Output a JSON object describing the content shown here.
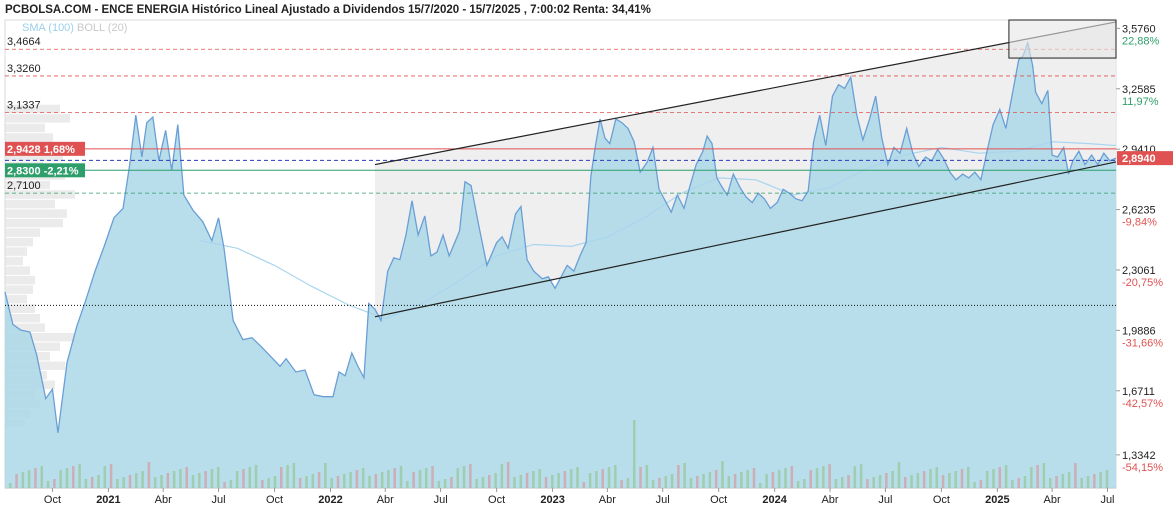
{
  "header": {
    "title": "PCBOLSA.COM - ENCE ENERGIA Histórico Lineal Ajustado a Dividendos 15/7/2020 - 15/7/2025 , 7:00:02 Renta: 34,41%",
    "indicator_sma": "SMA (100)",
    "indicator_boll": "BOLL (20)"
  },
  "colors": {
    "area_fill": "#aad8e6",
    "price_line": "#6a9fd6",
    "sma_line": "#a9d5ef",
    "channel_fill": "#ececec",
    "red": "#e05252",
    "green": "#2e9e6a",
    "blue_dash": "#2b3bb5",
    "volume": "#9cc9a5"
  },
  "chart_data": {
    "type": "area",
    "x_range": [
      "2020-07-15",
      "2025-07-15"
    ],
    "ylim": [
      1.16,
      3.62
    ],
    "right_axis": [
      {
        "value": 3.576,
        "label": "3,5760",
        "pct": "22,88%"
      },
      {
        "value": 3.2585,
        "label": "3,2585",
        "pct": "11,97%"
      },
      {
        "value": 2.941,
        "label": "2,9410",
        "pct": ""
      },
      {
        "value": 2.6235,
        "label": "2,6235",
        "pct": "-9,84%"
      },
      {
        "value": 2.3061,
        "label": "2,3061",
        "pct": "-20,75%"
      },
      {
        "value": 1.9886,
        "label": "1,9886",
        "pct": "-31,66%"
      },
      {
        "value": 1.6711,
        "label": "1,6711",
        "pct": "-42,57%"
      },
      {
        "value": 1.3342,
        "label": "1,3342",
        "pct": "-54,15%"
      }
    ],
    "current_price": {
      "value": 2.894,
      "label": "2,8940"
    },
    "red_dashed_levels": [
      {
        "value": 3.4664,
        "label": "3,4664"
      },
      {
        "value": 3.326,
        "label": "3,3260"
      },
      {
        "value": 3.1337,
        "label": "3,1337"
      }
    ],
    "green_dashed_levels": [
      {
        "value": 2.71,
        "label": "2,7100"
      }
    ],
    "solid_levels": [
      {
        "value": 2.9428,
        "label": "2,9428",
        "pct": "1,68%",
        "color": "red"
      },
      {
        "value": 2.83,
        "label": "2,8300",
        "pct": "-2,21%",
        "color": "green"
      }
    ],
    "blue_dashed_level": 2.882,
    "dotted_level": 2.12,
    "channel": {
      "upper": [
        [
          "2022-03-15",
          2.86
        ],
        [
          "2025-07-15",
          3.61
        ]
      ],
      "lower": [
        [
          "2022-03-15",
          2.06
        ],
        [
          "2025-07-15",
          2.874
        ]
      ]
    },
    "highlight_box": {
      "x": [
        "2025-01-20",
        "2025-07-15"
      ],
      "y": [
        3.42,
        3.62
      ]
    },
    "x_ticks": [
      {
        "date": "2020-10-01",
        "label": "Oct",
        "bold": false
      },
      {
        "date": "2021-01-01",
        "label": "2021",
        "bold": true
      },
      {
        "date": "2021-04-01",
        "label": "Abr",
        "bold": false
      },
      {
        "date": "2021-07-01",
        "label": "Jul",
        "bold": false
      },
      {
        "date": "2021-10-01",
        "label": "Oct",
        "bold": false
      },
      {
        "date": "2022-01-01",
        "label": "2022",
        "bold": true
      },
      {
        "date": "2022-04-01",
        "label": "Abr",
        "bold": false
      },
      {
        "date": "2022-07-01",
        "label": "Jul",
        "bold": false
      },
      {
        "date": "2022-10-01",
        "label": "Oct",
        "bold": false
      },
      {
        "date": "2023-01-01",
        "label": "2023",
        "bold": true
      },
      {
        "date": "2023-04-01",
        "label": "Abr",
        "bold": false
      },
      {
        "date": "2023-07-01",
        "label": "Jul",
        "bold": false
      },
      {
        "date": "2023-10-01",
        "label": "Oct",
        "bold": false
      },
      {
        "date": "2024-01-01",
        "label": "2024",
        "bold": true
      },
      {
        "date": "2024-04-01",
        "label": "Abr",
        "bold": false
      },
      {
        "date": "2024-07-01",
        "label": "Jul",
        "bold": false
      },
      {
        "date": "2024-10-01",
        "label": "Oct",
        "bold": false
      },
      {
        "date": "2025-01-01",
        "label": "2025",
        "bold": true
      },
      {
        "date": "2025-04-01",
        "label": "Abr",
        "bold": false
      },
      {
        "date": "2025-07-01",
        "label": "Jul",
        "bold": false
      }
    ],
    "price_series": [
      [
        "2020-07-15",
        2.19
      ],
      [
        "2020-07-28",
        2.02
      ],
      [
        "2020-08-10",
        1.99
      ],
      [
        "2020-08-25",
        1.98
      ],
      [
        "2020-09-05",
        1.86
      ],
      [
        "2020-09-20",
        1.63
      ],
      [
        "2020-10-01",
        1.68
      ],
      [
        "2020-10-10",
        1.45
      ],
      [
        "2020-10-25",
        1.82
      ],
      [
        "2020-11-10",
        2.01
      ],
      [
        "2020-11-25",
        2.15
      ],
      [
        "2020-12-10",
        2.3
      ],
      [
        "2020-12-25",
        2.43
      ],
      [
        "2021-01-10",
        2.58
      ],
      [
        "2021-01-25",
        2.63
      ],
      [
        "2021-02-05",
        2.86
      ],
      [
        "2021-02-15",
        3.12
      ],
      [
        "2021-02-25",
        2.9
      ],
      [
        "2021-03-05",
        3.08
      ],
      [
        "2021-03-15",
        3.11
      ],
      [
        "2021-03-25",
        2.88
      ],
      [
        "2021-04-05",
        3.04
      ],
      [
        "2021-04-15",
        2.83
      ],
      [
        "2021-04-25",
        3.07
      ],
      [
        "2021-05-05",
        2.7
      ],
      [
        "2021-05-20",
        2.62
      ],
      [
        "2021-06-05",
        2.56
      ],
      [
        "2021-06-20",
        2.46
      ],
      [
        "2021-07-01",
        2.58
      ],
      [
        "2021-07-10",
        2.42
      ],
      [
        "2021-07-25",
        2.04
      ],
      [
        "2021-08-10",
        1.94
      ],
      [
        "2021-08-25",
        1.95
      ],
      [
        "2021-09-10",
        1.9
      ],
      [
        "2021-09-25",
        1.85
      ],
      [
        "2021-10-10",
        1.8
      ],
      [
        "2021-10-20",
        1.84
      ],
      [
        "2021-11-05",
        1.77
      ],
      [
        "2021-11-20",
        1.78
      ],
      [
        "2021-12-05",
        1.65
      ],
      [
        "2021-12-20",
        1.64
      ],
      [
        "2022-01-05",
        1.64
      ],
      [
        "2022-01-15",
        1.77
      ],
      [
        "2022-01-25",
        1.75
      ],
      [
        "2022-02-05",
        1.87
      ],
      [
        "2022-02-15",
        1.8
      ],
      [
        "2022-02-25",
        1.74
      ],
      [
        "2022-03-05",
        2.13
      ],
      [
        "2022-03-15",
        2.1
      ],
      [
        "2022-03-25",
        2.04
      ],
      [
        "2022-04-05",
        2.3
      ],
      [
        "2022-04-15",
        2.37
      ],
      [
        "2022-04-25",
        2.36
      ],
      [
        "2022-05-05",
        2.49
      ],
      [
        "2022-05-15",
        2.67
      ],
      [
        "2022-05-25",
        2.49
      ],
      [
        "2022-06-05",
        2.59
      ],
      [
        "2022-06-15",
        2.38
      ],
      [
        "2022-06-25",
        2.4
      ],
      [
        "2022-07-05",
        2.49
      ],
      [
        "2022-07-15",
        2.38
      ],
      [
        "2022-08-01",
        2.51
      ],
      [
        "2022-08-10",
        2.77
      ],
      [
        "2022-08-20",
        2.75
      ],
      [
        "2022-09-01",
        2.55
      ],
      [
        "2022-09-15",
        2.33
      ],
      [
        "2022-10-01",
        2.45
      ],
      [
        "2022-10-10",
        2.48
      ],
      [
        "2022-10-20",
        2.42
      ],
      [
        "2022-11-01",
        2.6
      ],
      [
        "2022-11-10",
        2.64
      ],
      [
        "2022-11-20",
        2.36
      ],
      [
        "2022-12-01",
        2.3
      ],
      [
        "2022-12-15",
        2.26
      ],
      [
        "2022-12-25",
        2.27
      ],
      [
        "2023-01-05",
        2.21
      ],
      [
        "2023-01-15",
        2.27
      ],
      [
        "2023-01-25",
        2.33
      ],
      [
        "2023-02-05",
        2.3
      ],
      [
        "2023-02-15",
        2.38
      ],
      [
        "2023-02-25",
        2.45
      ],
      [
        "2023-03-05",
        2.8
      ],
      [
        "2023-03-12",
        2.95
      ],
      [
        "2023-03-20",
        3.1
      ],
      [
        "2023-03-28",
        3.0
      ],
      [
        "2023-04-05",
        2.97
      ],
      [
        "2023-04-15",
        3.1
      ],
      [
        "2023-04-25",
        3.08
      ],
      [
        "2023-05-05",
        3.05
      ],
      [
        "2023-05-15",
        2.98
      ],
      [
        "2023-05-25",
        2.82
      ],
      [
        "2023-06-05",
        2.87
      ],
      [
        "2023-06-15",
        2.95
      ],
      [
        "2023-06-25",
        2.73
      ],
      [
        "2023-07-05",
        2.67
      ],
      [
        "2023-07-15",
        2.61
      ],
      [
        "2023-07-25",
        2.7
      ],
      [
        "2023-08-05",
        2.63
      ],
      [
        "2023-08-15",
        2.75
      ],
      [
        "2023-08-25",
        2.86
      ],
      [
        "2023-09-05",
        2.93
      ],
      [
        "2023-09-12",
        3.01
      ],
      [
        "2023-09-20",
        2.97
      ],
      [
        "2023-09-28",
        2.79
      ],
      [
        "2023-10-05",
        2.75
      ],
      [
        "2023-10-15",
        2.7
      ],
      [
        "2023-10-25",
        2.81
      ],
      [
        "2023-11-05",
        2.74
      ],
      [
        "2023-11-15",
        2.69
      ],
      [
        "2023-11-25",
        2.66
      ],
      [
        "2023-12-05",
        2.71
      ],
      [
        "2023-12-15",
        2.68
      ],
      [
        "2023-12-25",
        2.63
      ],
      [
        "2024-01-05",
        2.66
      ],
      [
        "2024-01-15",
        2.73
      ],
      [
        "2024-01-25",
        2.71
      ],
      [
        "2024-02-05",
        2.68
      ],
      [
        "2024-02-15",
        2.67
      ],
      [
        "2024-02-25",
        2.72
      ],
      [
        "2024-03-05",
        2.98
      ],
      [
        "2024-03-15",
        3.12
      ],
      [
        "2024-03-25",
        2.96
      ],
      [
        "2024-04-05",
        3.22
      ],
      [
        "2024-04-15",
        3.28
      ],
      [
        "2024-04-25",
        3.26
      ],
      [
        "2024-05-05",
        3.32
      ],
      [
        "2024-05-15",
        3.12
      ],
      [
        "2024-05-25",
        2.99
      ],
      [
        "2024-06-05",
        3.1
      ],
      [
        "2024-06-15",
        3.22
      ],
      [
        "2024-06-25",
        3.0
      ],
      [
        "2024-07-05",
        2.86
      ],
      [
        "2024-07-15",
        2.95
      ],
      [
        "2024-07-25",
        2.92
      ],
      [
        "2024-08-05",
        3.05
      ],
      [
        "2024-08-15",
        2.92
      ],
      [
        "2024-08-25",
        2.85
      ],
      [
        "2024-09-05",
        2.9
      ],
      [
        "2024-09-15",
        2.88
      ],
      [
        "2024-09-25",
        2.94
      ],
      [
        "2024-10-05",
        2.89
      ],
      [
        "2024-10-15",
        2.82
      ],
      [
        "2024-10-25",
        2.78
      ],
      [
        "2024-11-05",
        2.81
      ],
      [
        "2024-11-15",
        2.79
      ],
      [
        "2024-11-25",
        2.82
      ],
      [
        "2024-12-05",
        2.78
      ],
      [
        "2024-12-15",
        2.93
      ],
      [
        "2024-12-25",
        3.07
      ],
      [
        "2025-01-05",
        3.15
      ],
      [
        "2025-01-15",
        3.05
      ],
      [
        "2025-01-25",
        3.22
      ],
      [
        "2025-02-05",
        3.41
      ],
      [
        "2025-02-12",
        3.43
      ],
      [
        "2025-02-20",
        3.5
      ],
      [
        "2025-02-28",
        3.38
      ],
      [
        "2025-03-05",
        3.24
      ],
      [
        "2025-03-15",
        3.18
      ],
      [
        "2025-03-25",
        3.25
      ],
      [
        "2025-04-01",
        2.91
      ],
      [
        "2025-04-10",
        2.9
      ],
      [
        "2025-04-20",
        2.95
      ],
      [
        "2025-04-28",
        2.81
      ],
      [
        "2025-05-05",
        2.88
      ],
      [
        "2025-05-15",
        2.93
      ],
      [
        "2025-05-25",
        2.86
      ],
      [
        "2025-06-05",
        2.91
      ],
      [
        "2025-06-15",
        2.86
      ],
      [
        "2025-06-25",
        2.92
      ],
      [
        "2025-07-05",
        2.88
      ],
      [
        "2025-07-15",
        2.894
      ]
    ],
    "sma_series": [
      [
        "2021-06-01",
        2.46
      ],
      [
        "2021-08-01",
        2.42
      ],
      [
        "2021-10-01",
        2.33
      ],
      [
        "2021-12-01",
        2.22
      ],
      [
        "2022-02-01",
        2.12
      ],
      [
        "2022-04-01",
        2.05
      ],
      [
        "2022-06-01",
        2.13
      ],
      [
        "2022-08-01",
        2.25
      ],
      [
        "2022-10-01",
        2.38
      ],
      [
        "2022-12-01",
        2.44
      ],
      [
        "2023-02-01",
        2.43
      ],
      [
        "2023-04-01",
        2.48
      ],
      [
        "2023-06-01",
        2.58
      ],
      [
        "2023-08-01",
        2.71
      ],
      [
        "2023-10-01",
        2.79
      ],
      [
        "2023-12-01",
        2.78
      ],
      [
        "2024-02-01",
        2.7
      ],
      [
        "2024-04-01",
        2.74
      ],
      [
        "2024-06-01",
        2.84
      ],
      [
        "2024-08-01",
        2.91
      ],
      [
        "2024-10-01",
        2.95
      ],
      [
        "2024-12-01",
        2.92
      ],
      [
        "2025-02-01",
        2.93
      ],
      [
        "2025-04-01",
        2.98
      ],
      [
        "2025-06-01",
        2.97
      ],
      [
        "2025-07-15",
        2.96
      ]
    ]
  }
}
